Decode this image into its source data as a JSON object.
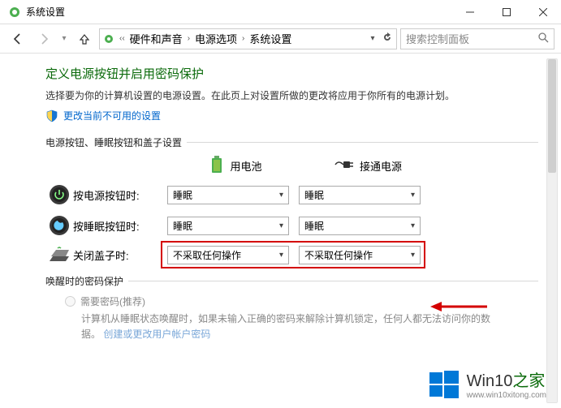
{
  "titlebar": {
    "title": "系统设置"
  },
  "breadcrumb": {
    "items": [
      "硬件和声音",
      "电源选项",
      "系统设置"
    ]
  },
  "search": {
    "placeholder": "搜索控制面板"
  },
  "heading": "定义电源按钮并启用密码保护",
  "description": "选择要为你的计算机设置的电源设置。在此页上对设置所做的更改将应用于你所有的电源计划。",
  "unavailable_link": "更改当前不可用的设置",
  "section1": "电源按钮、睡眠按钮和盖子设置",
  "col_headers": {
    "battery": "用电池",
    "ac": "接通电源"
  },
  "rows": {
    "power_button": {
      "label": "按电源按钮时:",
      "battery": "睡眠",
      "ac": "睡眠"
    },
    "sleep_button": {
      "label": "按睡眠按钮时:",
      "battery": "睡眠",
      "ac": "睡眠"
    },
    "close_lid": {
      "label": "关闭盖子时:",
      "battery": "不采取任何操作",
      "ac": "不采取任何操作"
    }
  },
  "section2": "唤醒时的密码保护",
  "radio": {
    "require": "需要密码(推荐)",
    "require_desc_a": "计算机从睡眠状态唤醒时，如果未输入正确的密码来解除计算机锁定，任何人都无法访问你的数据。",
    "require_link": "创建或更改用户帐户密码"
  },
  "watermark": {
    "brand": "Win10",
    "suffix": "之家",
    "url": "www.win10xitong.com"
  }
}
